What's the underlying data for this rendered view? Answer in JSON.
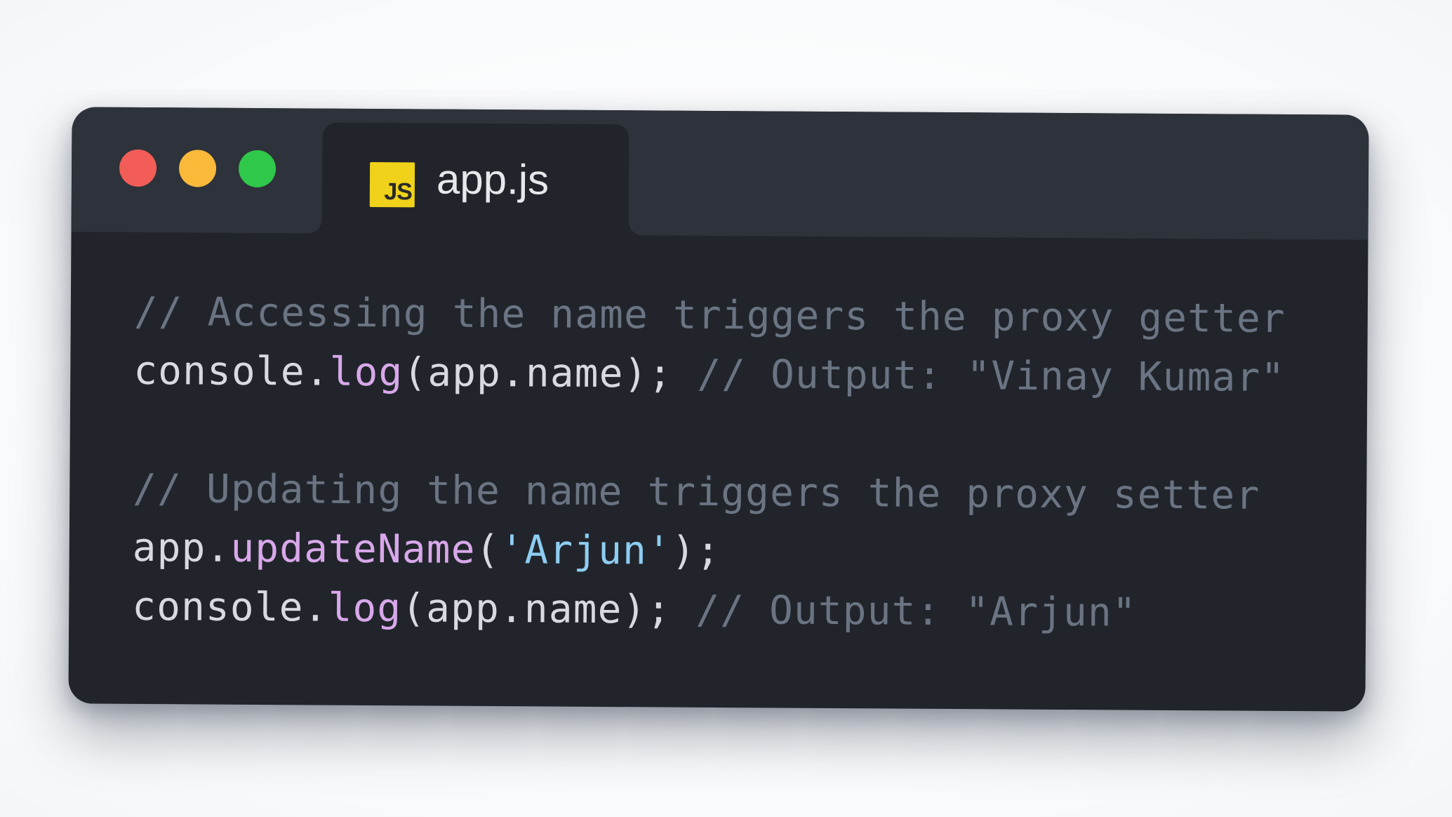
{
  "window": {
    "traffic_lights": [
      {
        "name": "close",
        "color": "#f25d57"
      },
      {
        "name": "minimize",
        "color": "#fbb93a"
      },
      {
        "name": "maximize",
        "color": "#2fc84a"
      }
    ]
  },
  "tab": {
    "badge_text": "JS",
    "badge_color": "#f0d21a",
    "file_name": "app.js"
  },
  "code": {
    "lines": [
      [
        {
          "text": "// Accessing the name triggers the proxy getter",
          "kind": "comment"
        }
      ],
      [
        {
          "text": "console.",
          "kind": "ident"
        },
        {
          "text": "log",
          "kind": "fn"
        },
        {
          "text": "(app.name); ",
          "kind": "ident"
        },
        {
          "text": "// Output: \"Vinay Kumar\"",
          "kind": "comment"
        }
      ],
      [],
      [
        {
          "text": "// Updating the name triggers the proxy setter",
          "kind": "comment"
        }
      ],
      [
        {
          "text": "app.",
          "kind": "ident"
        },
        {
          "text": "updateName",
          "kind": "fn"
        },
        {
          "text": "(",
          "kind": "ident"
        },
        {
          "text": "'Arjun'",
          "kind": "str"
        },
        {
          "text": ");",
          "kind": "ident"
        }
      ],
      [
        {
          "text": "console.",
          "kind": "ident"
        },
        {
          "text": "log",
          "kind": "fn"
        },
        {
          "text": "(app.name); ",
          "kind": "ident"
        },
        {
          "text": "// Output: \"Arjun\"",
          "kind": "comment"
        }
      ]
    ]
  }
}
